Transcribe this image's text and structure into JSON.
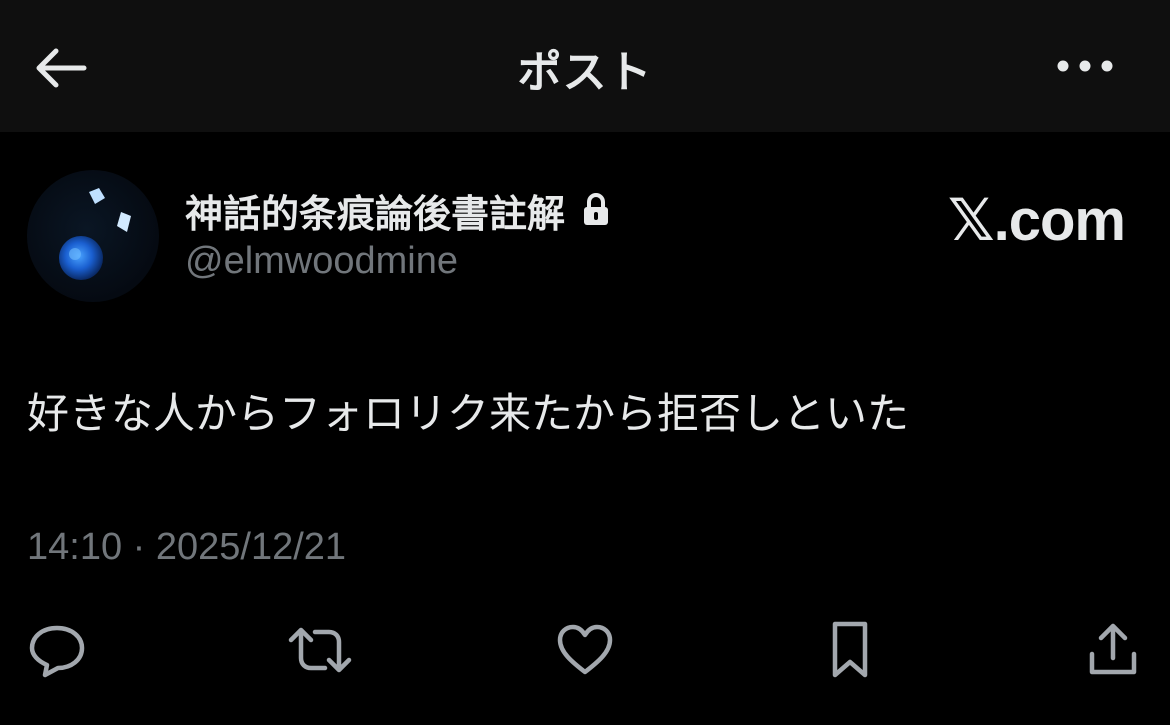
{
  "header": {
    "title": "ポスト",
    "back_icon": "arrow-left-icon",
    "more_icon": "more-horizontal-icon"
  },
  "author": {
    "display_name": "神話的条痕論後書註解",
    "handle": "@elmwoodmine",
    "protected_icon": "lock-icon"
  },
  "brand": "𝕏.com",
  "post": {
    "text": "好きな人からフォロリク来たから拒否しといた",
    "timestamp": "14:10 · 2025/12/21"
  },
  "actions": {
    "reply_icon": "reply-icon",
    "repost_icon": "repost-icon",
    "like_icon": "heart-icon",
    "bookmark_icon": "bookmark-icon",
    "share_icon": "share-icon"
  },
  "colors": {
    "background": "#000000",
    "header_background": "#0f0f0f",
    "primary_text": "#e7e9ea",
    "secondary_text": "#71767b",
    "icon": "#a2a7ad"
  }
}
